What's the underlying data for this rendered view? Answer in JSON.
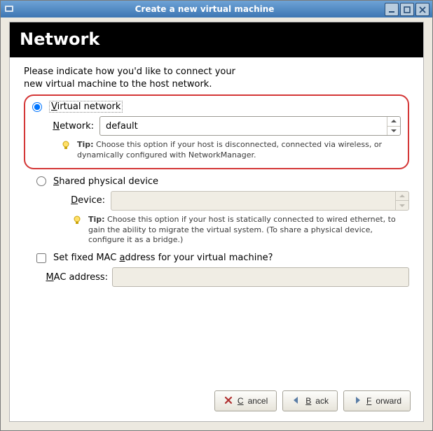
{
  "window": {
    "title": "Create a new virtual machine"
  },
  "banner": {
    "heading": "Network"
  },
  "intro": {
    "line1": "Please indicate how you'd like to connect your",
    "line2": "new virtual machine to the host network."
  },
  "option_virtual": {
    "label": "Virtual network",
    "network_label": "Network:",
    "network_value": "default",
    "tip_bold": "Tip:",
    "tip_text": " Choose this option if your host is disconnected, connected via wireless, or dynamically configured with NetworkManager."
  },
  "option_shared": {
    "label_pre": "S",
    "label_text": "hared physical device",
    "device_label_pre": "D",
    "device_label_text": "evice:",
    "device_value": "",
    "tip_bold": "Tip:",
    "tip_text": " Choose this option if your host is statically connected to wired ethernet, to gain the ability to migrate the virtual system. (To share a physical device, configure it as a bridge.)"
  },
  "mac": {
    "check_label_pre": "Set fixed MAC ",
    "check_label_u": "a",
    "check_label_post": "ddress for your virtual machine?",
    "field_label_pre": "M",
    "field_label_text": "AC address:",
    "value": ""
  },
  "buttons": {
    "cancel": "Cancel",
    "back": "Back",
    "forward": "Forward"
  },
  "u": {
    "V": "V",
    "N": "N"
  }
}
